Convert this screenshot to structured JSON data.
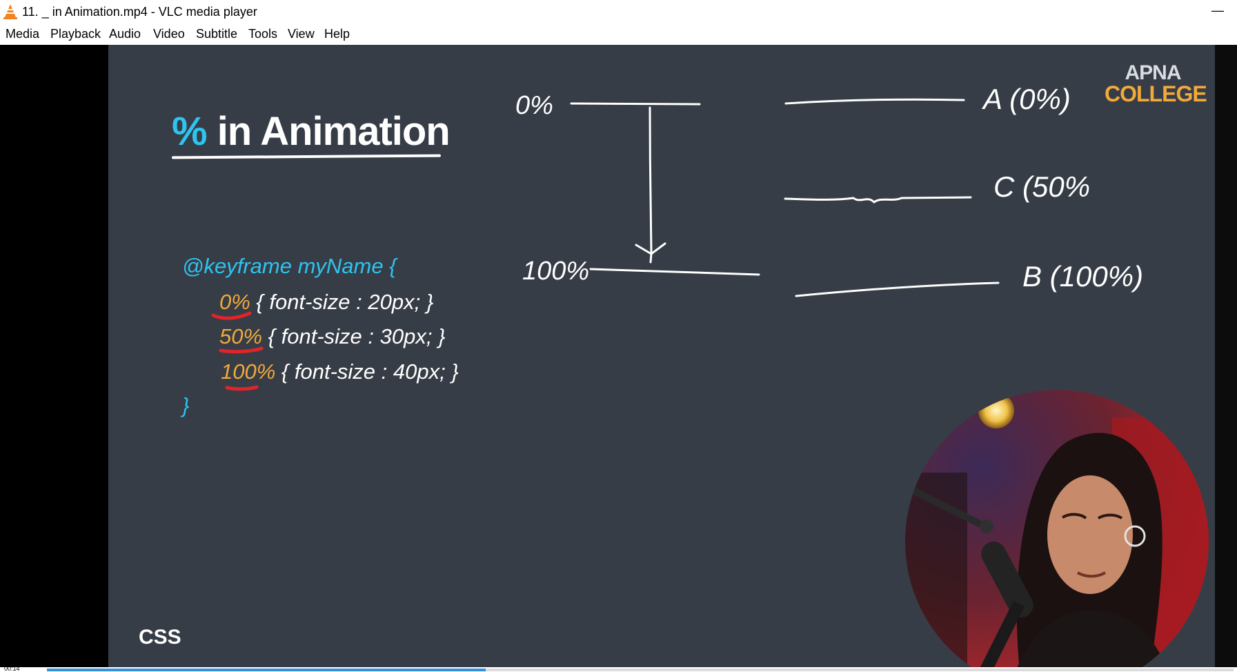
{
  "window": {
    "title": "11. _ in Animation.mp4 - VLC media player",
    "minimize_glyph": "—"
  },
  "menu": [
    "Media",
    "Playback",
    "Audio",
    "Video",
    "Subtitle",
    "Tools",
    "View",
    "Help"
  ],
  "slide": {
    "title_pct": "%",
    "title_rest": " in Animation",
    "code": {
      "open": "@keyframe myName {",
      "lines": [
        {
          "pct": "0%",
          "body": " { font-size : 20px; }"
        },
        {
          "pct": "50%",
          "body": " { font-size : 30px; }"
        },
        {
          "pct": "100%",
          "body": " { font-size : 40px; }"
        }
      ],
      "close": "}"
    },
    "handwriting": {
      "top_left": "0%",
      "bottom_left": "100%",
      "A": "A (0%)",
      "C": "C (50%",
      "B": "B (100%)"
    },
    "brand_line1": "APNA",
    "brand_line2": "COLLEGE",
    "footer": "CSS"
  },
  "player": {
    "time": "00:14",
    "progress": 0.37
  },
  "colors": {
    "slide_bg": "#373d46",
    "accent_blue": "#2ec4f0",
    "accent_orange": "#f2a93b",
    "annotation_red": "#e0242a",
    "progress_fill": "#3a8fd9"
  }
}
